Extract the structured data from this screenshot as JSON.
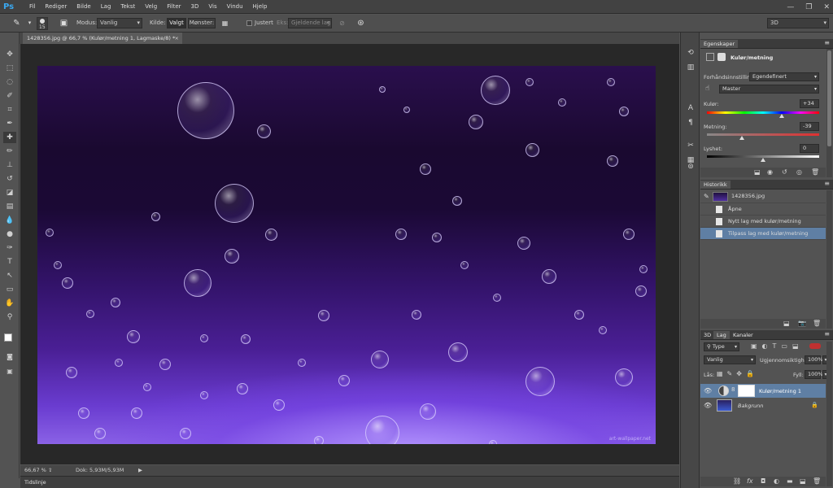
{
  "app": {
    "logo": "Ps"
  },
  "menu": [
    "Fil",
    "Rediger",
    "Bilde",
    "Lag",
    "Tekst",
    "Velg",
    "Filter",
    "3D",
    "Vis",
    "Vindu",
    "Hjelp"
  ],
  "window_controls": {
    "minimize": "—",
    "restore": "❐",
    "close": "✕"
  },
  "options_bar": {
    "brush_size": "15",
    "mode_label": "Modus:",
    "mode_value": "Vanlig",
    "source_label": "Kilde:",
    "source_selected": "Valgt",
    "source_pattern": "Mønster:",
    "align_label": "Justert",
    "sample_label": "Eks:",
    "sample_value": "Gjeldende lag",
    "workspace": "3D"
  },
  "document": {
    "tab_title": "1428356.jpg @ 66,7 % (Kulør/metning 1, Lagmaske/8) *",
    "watermark": "art-wallpaper.net",
    "zoom": "66,67 %",
    "doc_info": "Dok: 5,93M/5,93M",
    "timeline_label": "Tidslinje"
  },
  "properties_panel": {
    "tab": "Egenskaper",
    "title": "Kulør/metning",
    "preset_label": "Forhåndsinnstilling:",
    "preset_value": "Egendefinert",
    "channel_value": "Master",
    "hue_label": "Kulør:",
    "hue_value": "+34",
    "saturation_label": "Metning:",
    "saturation_value": "-39",
    "lightness_label": "Lyshet:",
    "lightness_value": "0",
    "hue_fraction": 0.67,
    "saturation_fraction": 0.31,
    "lightness_fraction": 0.5
  },
  "history_panel": {
    "tab": "Historikk",
    "snapshot": "1428356.jpg",
    "items": [
      "Åpne",
      "Nytt lag med kulør/metning",
      "Tilpass lag med kulør/metning"
    ]
  },
  "layers_panel": {
    "tabs": [
      "3D",
      "Lag",
      "Kanaler"
    ],
    "filter_label": "Type",
    "blend_mode": "Vanlig",
    "opacity_label": "Ugjennomsiktighet:",
    "opacity_value": "100%",
    "lock_label": "Lås:",
    "fill_label": "Fyll:",
    "fill_value": "100%",
    "layers": [
      {
        "name": "Kulør/metning 1"
      },
      {
        "name": "Bakgrunn"
      }
    ]
  },
  "colors": {
    "accent": "#3aa8f0",
    "selected_row": "#5f7fa4"
  }
}
